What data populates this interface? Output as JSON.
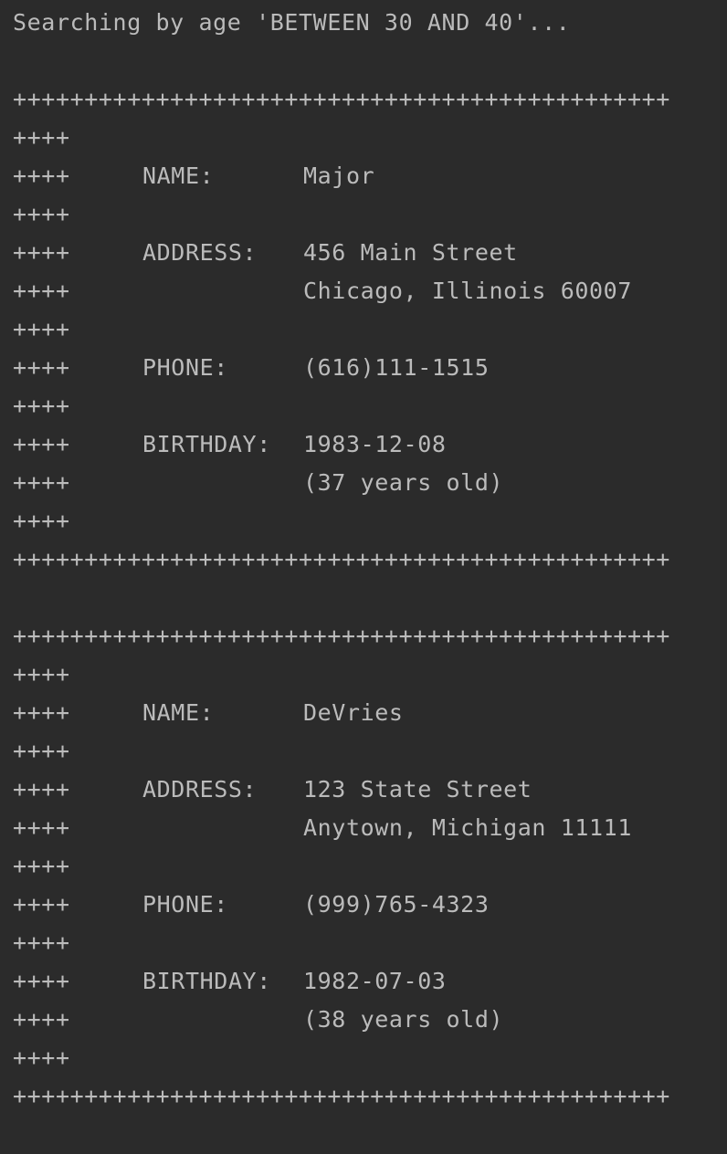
{
  "console": {
    "header": "Searching by age 'BETWEEN 30 AND 40'...",
    "border": "++++++++++++++++++++++++++++++++++++++++++++++",
    "prefix": "++++",
    "records": [
      {
        "name_label": "NAME:",
        "name": "Major",
        "address_label": "ADDRESS:",
        "address_line1": "456 Main Street",
        "address_line2": "Chicago, Illinois 60007",
        "phone_label": "PHONE:",
        "phone": "(616)111-1515",
        "birthday_label": "BIRTHDAY:",
        "birthday": "1983-12-08",
        "age_text": "(37 years old)"
      },
      {
        "name_label": "NAME:",
        "name": "DeVries",
        "address_label": "ADDRESS:",
        "address_line1": "123 State Street",
        "address_line2": "Anytown, Michigan 11111",
        "phone_label": "PHONE:",
        "phone": "(999)765-4323",
        "birthday_label": "BIRTHDAY:",
        "birthday": "1982-07-03",
        "age_text": "(38 years old)"
      }
    ]
  }
}
